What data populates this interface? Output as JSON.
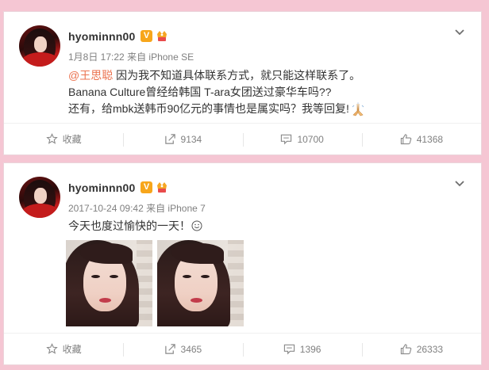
{
  "posts": [
    {
      "username": "hyominnn00",
      "vip_badge": "V",
      "timestamp": "1月8日 17:22",
      "source": "来自 iPhone SE",
      "mention": "@王思聪",
      "lines": [
        "因为我不知道具体联系方式，就只能这样联系了。",
        "Banana Culture曾经给韩国 T-ara女团送过豪华车吗??",
        "还有，给mbk送韩币90亿元的事情也是属实吗？我等回复!"
      ],
      "actions": {
        "favorite": "收藏",
        "repost": "9134",
        "comment": "10700",
        "like": "41368"
      }
    },
    {
      "username": "hyominnn00",
      "vip_badge": "V",
      "timestamp": "2017-10-24 09:42",
      "source": "来自 iPhone 7",
      "text": "今天也度过愉快的一天！",
      "actions": {
        "favorite": "收藏",
        "repost": "3465",
        "comment": "1396",
        "like": "26333"
      }
    }
  ],
  "colors": {
    "page_background": "#f5c6d3",
    "mention": "#eb7350",
    "vip_badge": "#f7a61b",
    "meta_text": "#808080"
  },
  "icons": [
    "chevron-down-icon",
    "vip-icon",
    "member-icon",
    "praying-hands-icon",
    "smile-icon",
    "star-icon",
    "repost-icon",
    "comment-icon",
    "thumbs-up-icon"
  ]
}
